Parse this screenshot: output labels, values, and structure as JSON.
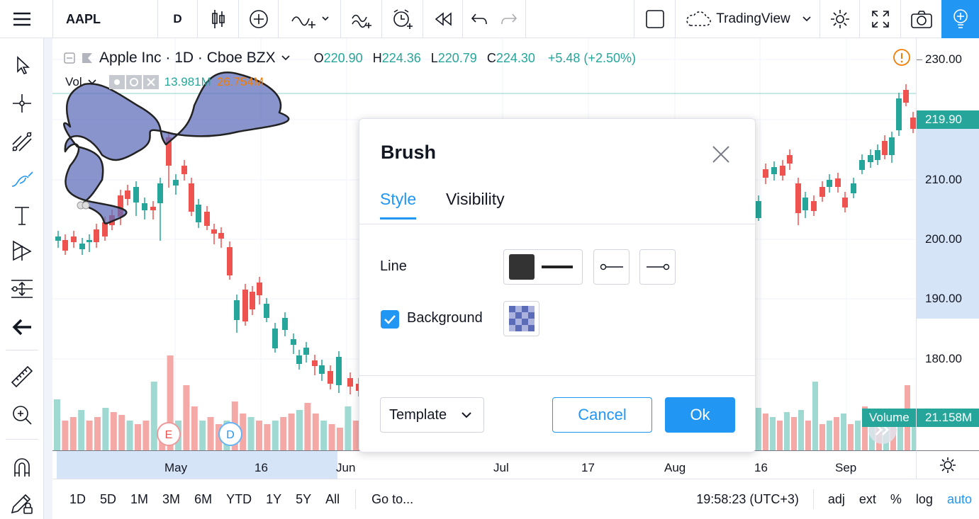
{
  "toolbar": {
    "symbol": "AAPL",
    "interval": "D",
    "layout_name": "TradingView"
  },
  "legend": {
    "title": "Apple Inc · 1D · Cboe BZX",
    "open_label": "O",
    "open": "220.90",
    "high_label": "H",
    "high": "224.36",
    "low_label": "L",
    "low": "220.79",
    "close_label": "C",
    "close": "224.30",
    "change": "+5.48 (+2.50%)",
    "vol_label": "Vol",
    "vol_value1": "13.981M",
    "vol_value2": "26.754M"
  },
  "price_scale": {
    "labels": [
      "230.00",
      "210.00",
      "200.00",
      "190.00",
      "180.00"
    ],
    "current_price": "219.90",
    "volume_label": "Volume",
    "volume_value": "21.158M"
  },
  "time_scale": {
    "labels": [
      "May",
      "16",
      "Jun",
      "Jul",
      "17",
      "Aug",
      "16",
      "Sep"
    ]
  },
  "events": {
    "earnings": "E",
    "dividend": "D"
  },
  "bottombar": {
    "ranges": [
      "1D",
      "5D",
      "1M",
      "3M",
      "6M",
      "YTD",
      "1Y",
      "5Y",
      "All"
    ],
    "goto": "Go to...",
    "clock": "19:58:23 (UTC+3)",
    "adj": "adj",
    "ext": "ext",
    "percent": "%",
    "log": "log",
    "auto": "auto"
  },
  "dialog": {
    "title": "Brush",
    "tabs": [
      "Style",
      "Visibility"
    ],
    "line_label": "Line",
    "background_label": "Background",
    "background_checked": true,
    "template_label": "Template",
    "cancel_label": "Cancel",
    "ok_label": "Ok"
  },
  "colors": {
    "accent": "#2196f3",
    "up": "#26a69a",
    "down": "#ef5350",
    "brush_fill": "#5c6bb8"
  }
}
